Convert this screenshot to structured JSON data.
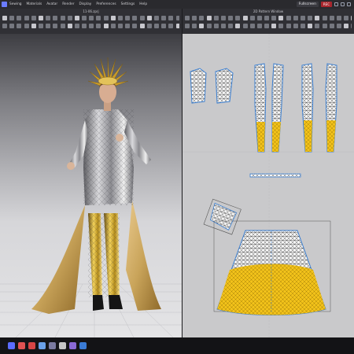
{
  "menu": {
    "items": [
      "Sewing",
      "Materials",
      "Avatar",
      "Render",
      "Display",
      "Preferences",
      "Settings",
      "Help"
    ],
    "fullscreen_label": "Fullscreen",
    "rec_label": "REC"
  },
  "views": {
    "view3d_title": "11-06.zprj",
    "view2d_title": "2D Pattern Window"
  },
  "icons": {
    "logo": "app-logo-icon",
    "window_controls": [
      "minimize-icon",
      "maximize-icon",
      "close-icon"
    ]
  },
  "taskbar": {
    "apps": [
      {
        "name": "app-icon",
        "color": "#5b6cff"
      },
      {
        "name": "app-icon",
        "color": "#e05252"
      },
      {
        "name": "app-icon",
        "color": "#d64545"
      },
      {
        "name": "app-icon",
        "color": "#6aa0e8"
      },
      {
        "name": "app-icon",
        "color": "#7a7aa0"
      },
      {
        "name": "app-icon",
        "color": "#c7c7c7"
      },
      {
        "name": "app-icon",
        "color": "#8a6ad6"
      },
      {
        "name": "app-icon",
        "color": "#3a7bd5"
      }
    ]
  },
  "colors": {
    "pattern_gold": "#f2c21a",
    "pattern_outline": "#3b7fd1",
    "fabric_gold": "#c9a45a"
  }
}
